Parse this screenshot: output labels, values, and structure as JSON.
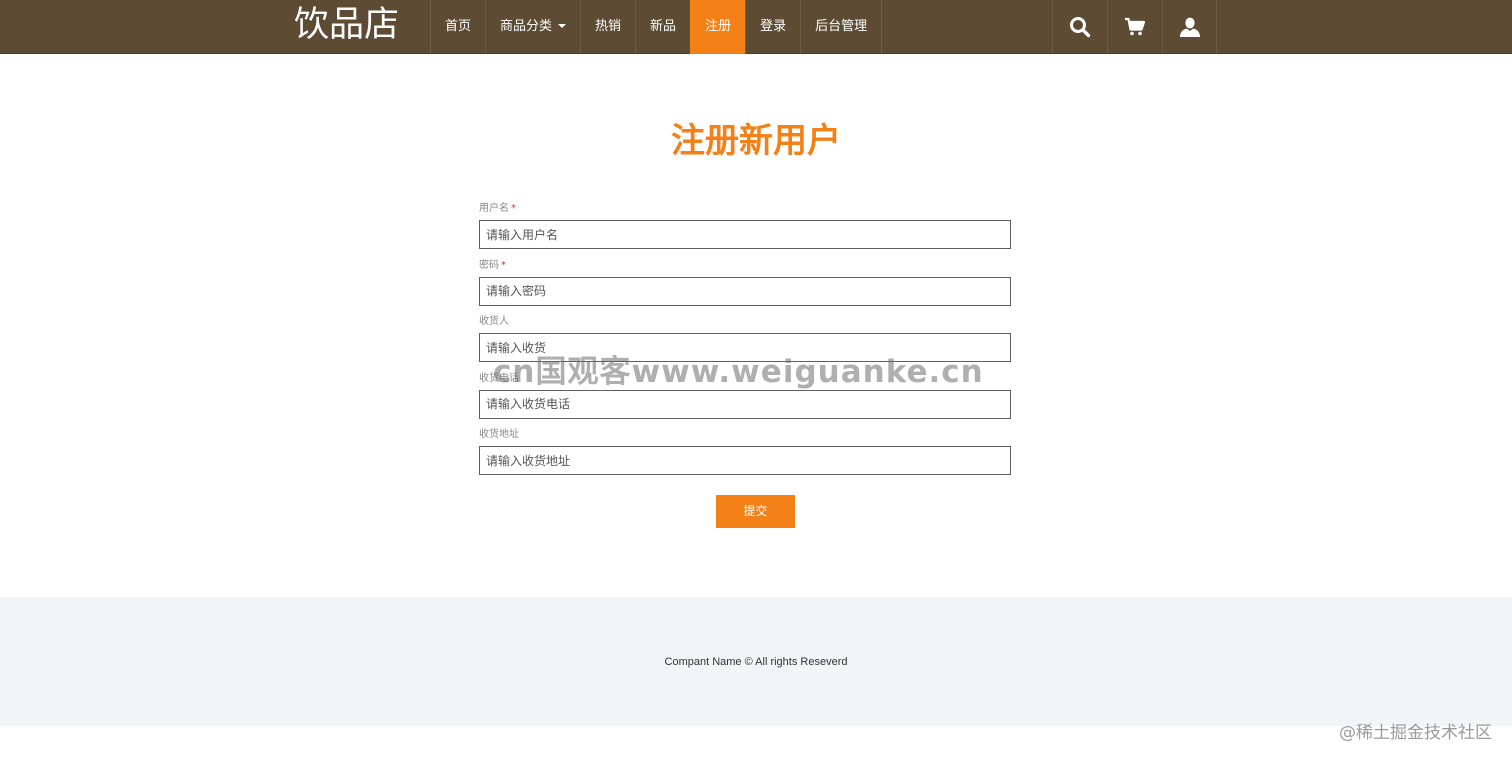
{
  "header": {
    "brand": "饮品店",
    "nav": [
      {
        "label": "首页"
      },
      {
        "label": "商品分类"
      },
      {
        "label": "热销"
      },
      {
        "label": "新品"
      },
      {
        "label": "注册"
      },
      {
        "label": "登录"
      },
      {
        "label": "后台管理"
      }
    ],
    "active_nav": "注册",
    "icons": [
      "search-icon",
      "cart-icon",
      "user-icon"
    ]
  },
  "main": {
    "title": "注册新用户",
    "fields": [
      {
        "label": "用户名",
        "required": "*",
        "placeholder": "请输入用户名",
        "value": ""
      },
      {
        "label": "密码",
        "required": "*",
        "placeholder": "请输入密码",
        "value": ""
      },
      {
        "label": "收货人",
        "placeholder": "请输入收货",
        "value": ""
      },
      {
        "label": "收货电话",
        "placeholder": "请输入收货电话",
        "value": ""
      },
      {
        "label": "收货地址",
        "placeholder": "请输入收货地址",
        "value": ""
      }
    ],
    "submit_label": "提交"
  },
  "watermark": "cn国观客www.weiguanke.cn",
  "footer": {
    "text": "Compant Name © All rights Reseverd"
  },
  "corner_watermark": "@稀土掘金技术社区",
  "colors": {
    "navbar": "#5e4b34",
    "accent": "#f48117",
    "footer_bg": "#f1f5f6",
    "required": "#e8302b"
  }
}
